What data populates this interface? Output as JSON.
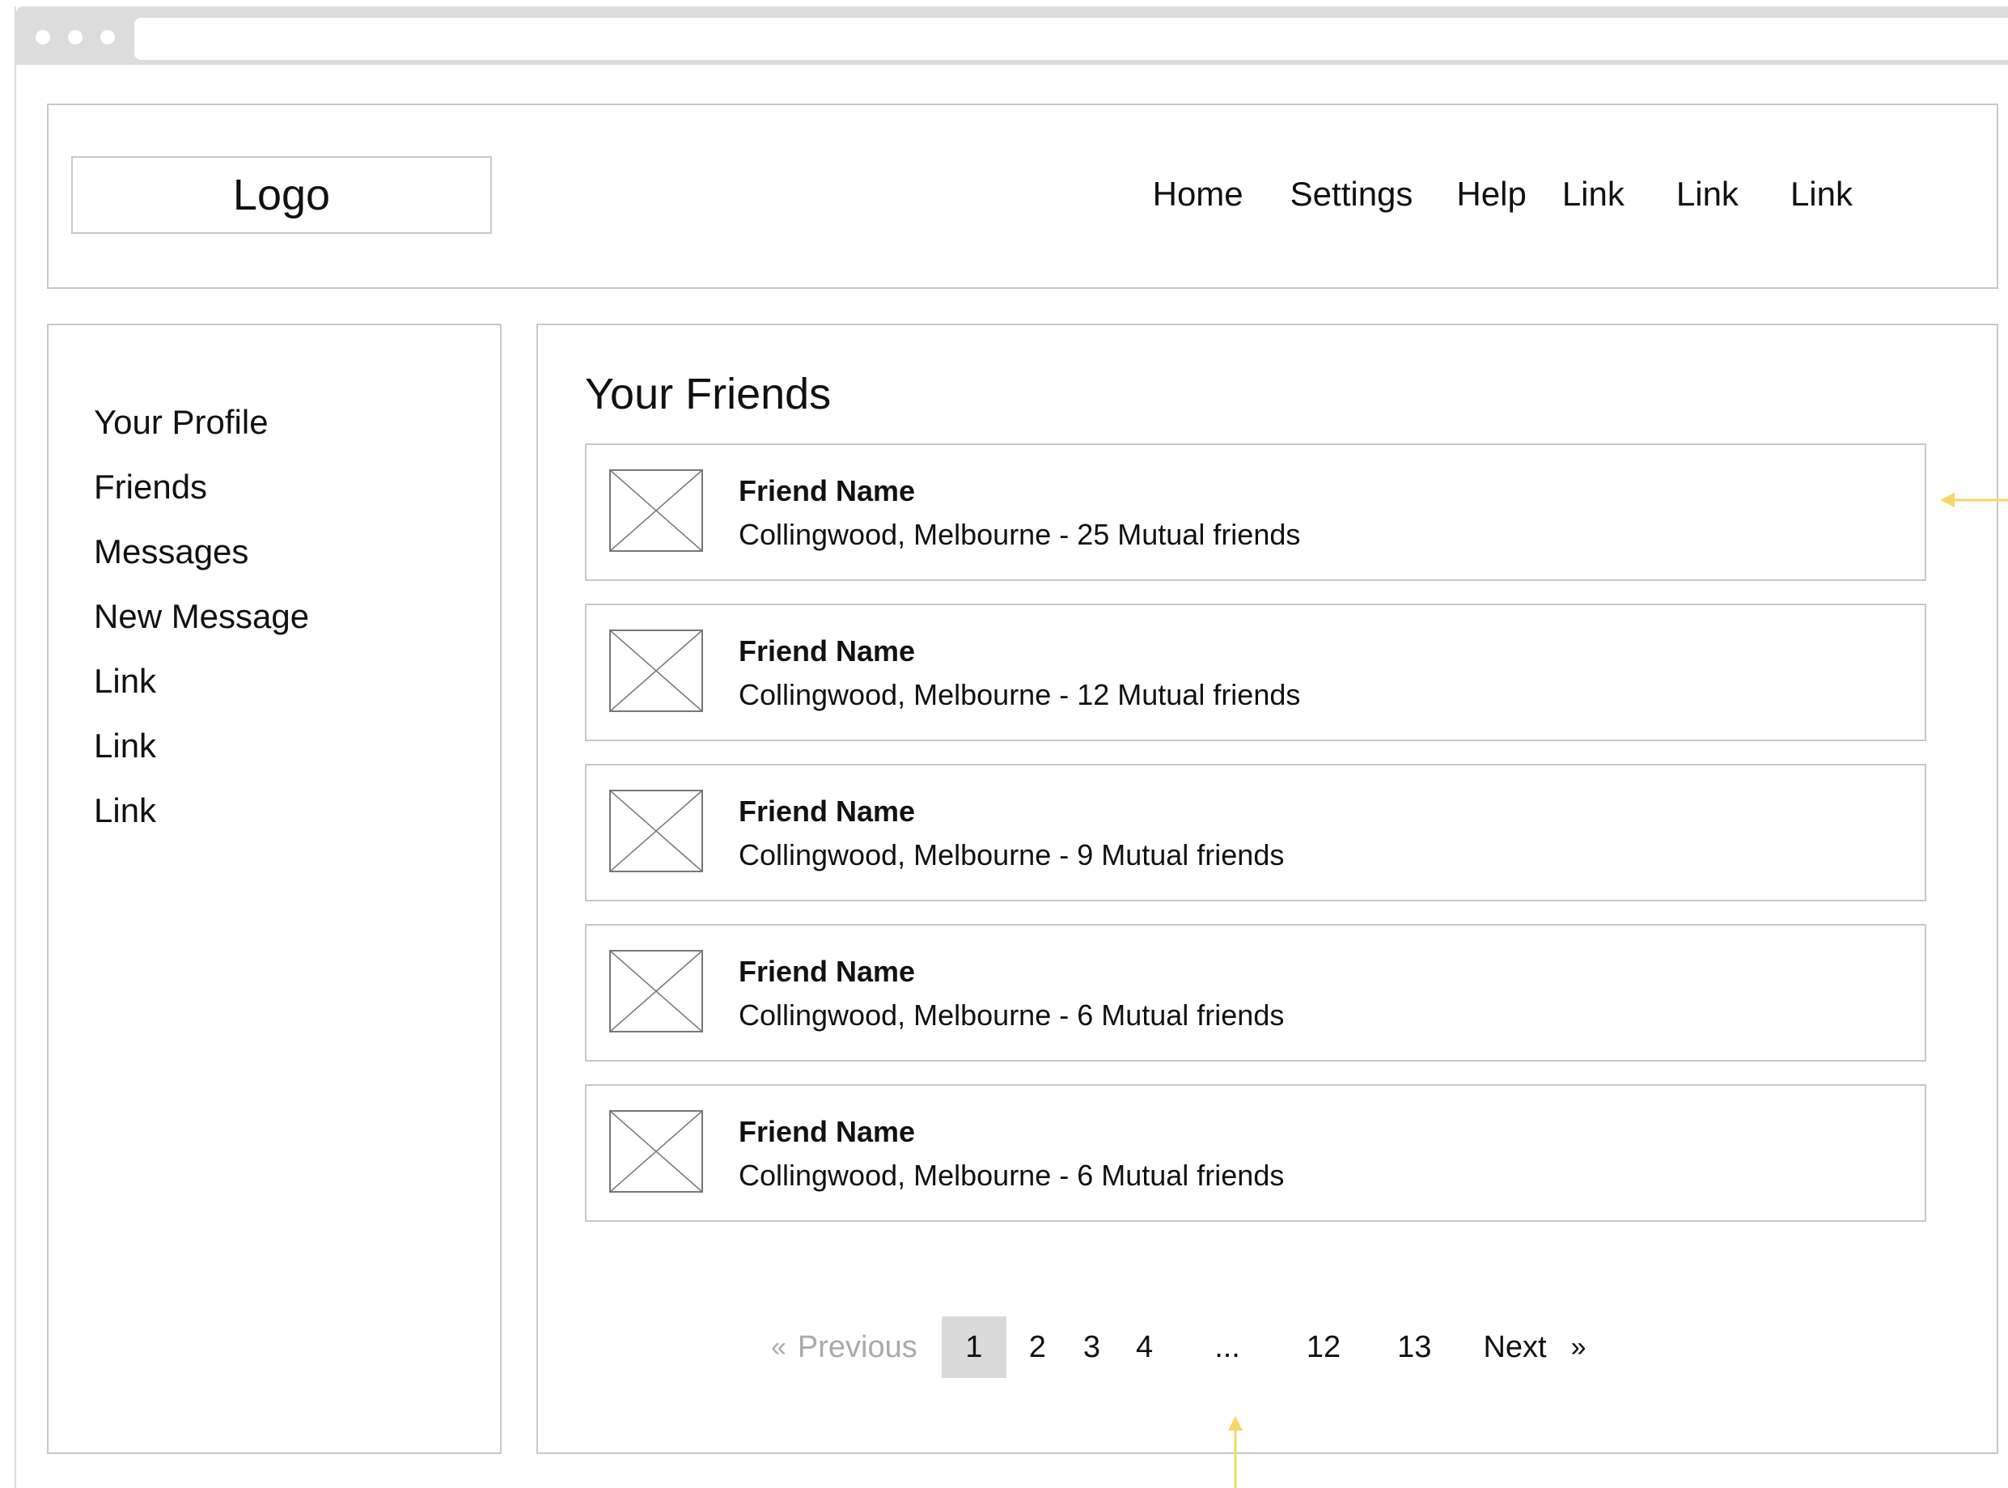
{
  "header": {
    "logo": "Logo",
    "nav": [
      "Home",
      "Settings",
      "Help",
      "Link",
      "Link",
      "Link"
    ]
  },
  "sidebar": {
    "items": [
      "Your Profile",
      "Friends",
      "Messages",
      "New Message",
      "Link",
      "Link",
      "Link"
    ]
  },
  "main": {
    "title": "Your Friends",
    "friends": [
      {
        "name": "Friend Name",
        "meta": "Collingwood, Melbourne - 25 Mutual friends"
      },
      {
        "name": "Friend Name",
        "meta": "Collingwood, Melbourne - 12 Mutual friends"
      },
      {
        "name": "Friend Name",
        "meta": "Collingwood, Melbourne - 9 Mutual friends"
      },
      {
        "name": "Friend Name",
        "meta": "Collingwood, Melbourne - 6 Mutual friends"
      },
      {
        "name": "Friend Name",
        "meta": "Collingwood, Melbourne - 6 Mutual friends"
      }
    ]
  },
  "pagination": {
    "prev_glyph": "«",
    "previous": "Previous",
    "pages": [
      "1",
      "2",
      "3",
      "4"
    ],
    "ellipsis": "...",
    "last_pages": [
      "12",
      "13"
    ],
    "next": "Next",
    "next_glyph": "»",
    "current": "1"
  },
  "colors": {
    "border": "#c8c8c8",
    "chrome": "#dcdcdc",
    "active_page": "#d9d9d9",
    "annotation": "#f5d66b"
  },
  "icons": {
    "thumbnail": "image-placeholder-icon",
    "annotation": "arrow-icon"
  }
}
